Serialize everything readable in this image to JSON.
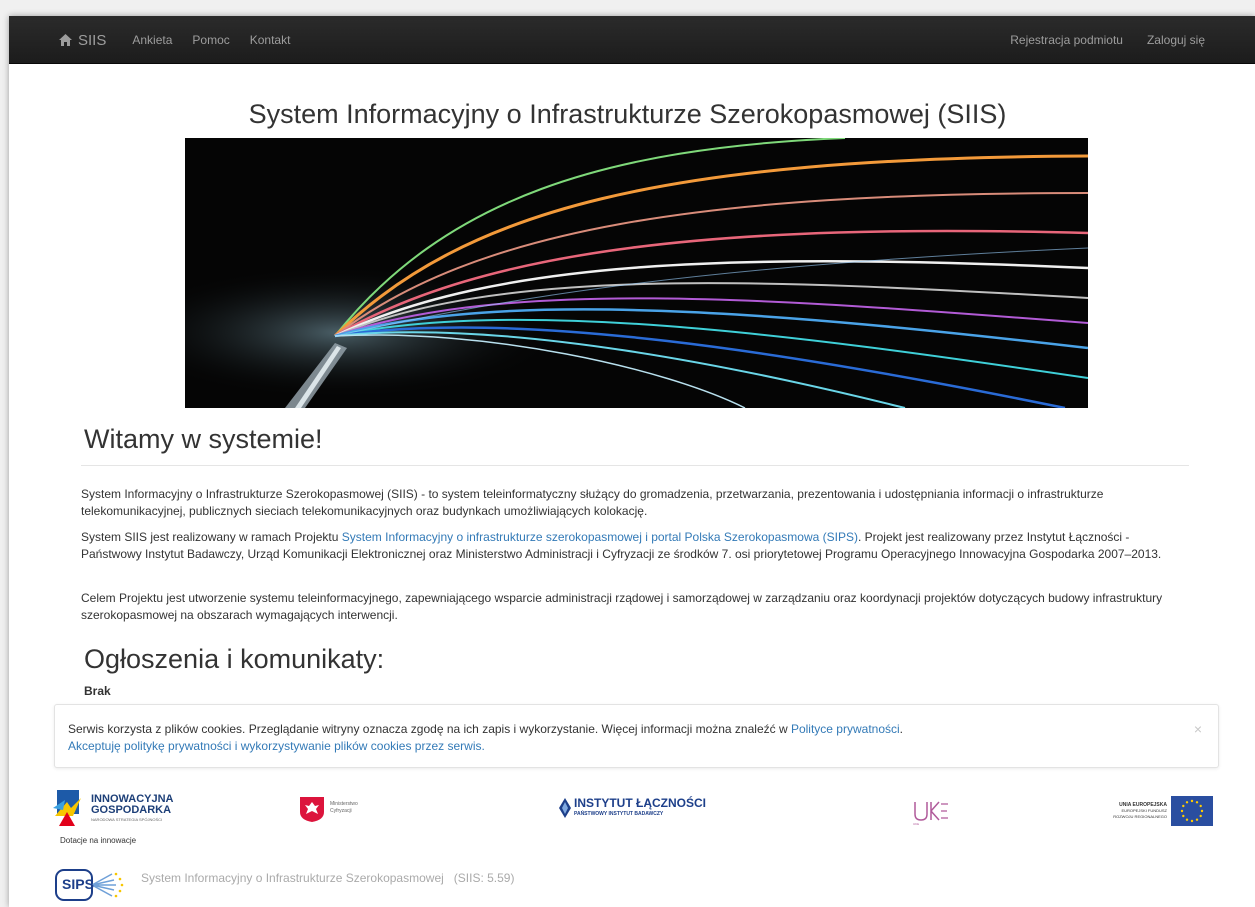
{
  "nav": {
    "brand": "SIIS",
    "links": [
      "Ankieta",
      "Pomoc",
      "Kontakt"
    ],
    "right_links": [
      "Rejestracja podmiotu",
      "Zaloguj się"
    ]
  },
  "page_title": "System Informacyjny o Infrastrukturze Szerokopasmowej (SIIS)",
  "welcome": {
    "heading": "Witamy w systemie!",
    "p1": "System Informacyjny o Infrastrukturze Szerokopasmowej (SIIS) - to system teleinformatyczny służący do gromadzenia, przetwarzania, prezentowania i udostępniania informacji o infrastrukturze telekomunikacyjnej, publicznych sieciach telekomunikacyjnych oraz budynkach umożliwiających kolokację.",
    "p2_before": "System SIIS jest realizowany w ramach Projektu ",
    "p2_link": "System Informacyjny o infrastrukturze szerokopasmowej i portal Polska Szerokopasmowa (SIPS)",
    "p2_after": ". Projekt jest realizowany przez Instytut Łączności - Państwowy Instytut Badawczy, Urząd Komunikacji Elektronicznej oraz Ministerstwo Administracji i Cyfryzacji ze środków 7. osi priorytetowej Programu Operacyjnego Innowacyjna Gospodarka 2007–2013.",
    "p3": "Celem Projektu jest utworzenie systemu teleinformacyjnego, zapewniającego wsparcie administracji rządowej i samorządowej w zarządzaniu oraz koordynacji projektów dotyczących budowy infrastruktury szerokopasmowej na obszarach wymagających interwencji."
  },
  "announcements": {
    "heading": "Ogłoszenia i komunikaty:",
    "value": "Brak"
  },
  "cookie": {
    "text": "Serwis korzysta z plików cookies. Przeglądanie witryny oznacza zgodę na ich zapis i wykorzystanie. Więcej informacji można znaleźć w ",
    "link": "Polityce prywatności",
    "text_end": ".",
    "accept": "Akceptuję politykę prywatności i wykorzystywanie plików cookies przez serwis.",
    "close": "×"
  },
  "logos": {
    "ig_line1": "INNOWACYJNA",
    "ig_line2": "GOSPODARKA",
    "ig_sub": "NARODOWA STRATEGIA SPÓJNOŚCI",
    "ig_caption": "Dotacje na innowacje",
    "min_line1": "Ministerstwo",
    "min_line2": "Cyfryzacji",
    "il_line1": "INSTYTUT ŁĄCZNOŚCI",
    "il_line2": "PAŃSTWOWY INSTYTUT BADAWCZY",
    "uke": "UKE",
    "eu_line1": "UNIA EUROPEJSKA",
    "eu_line2": "EUROPEJSKI FUNDUSZ",
    "eu_line3": "ROZWOJU REGIONALNEGO",
    "sips": "SIPS"
  },
  "footer": {
    "text": "System Informacyjny o Infrastrukturze Szerokopasmowej   (SIIS: 5.59)"
  },
  "colors": {
    "navbar": "#222222",
    "link": "#337ab7",
    "eu_blue": "#2a4ea0",
    "eu_star": "#ffcc00"
  }
}
